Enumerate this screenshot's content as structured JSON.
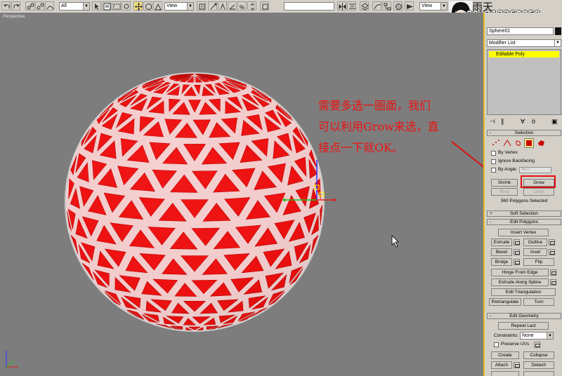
{
  "toolbar": {
    "selection_filter": "All",
    "ref_coord_1": "View",
    "ref_coord_2": "View",
    "named_selection": ""
  },
  "viewport": {
    "label": "Perspective",
    "annotation_lines": [
      "需要多选一圈面，我们",
      "可以利用Grow来选，直",
      "接点一下就OK。"
    ],
    "colors": {
      "background": "#7d7d7d",
      "sphere_face": "#ee1111",
      "sphere_edge": "#ffffff",
      "annotation": "#ee1111"
    }
  },
  "watermark": {
    "logo": "雨天",
    "qq": "QQ:313360058"
  },
  "command_panel": {
    "object_name": "Sphere01",
    "object_color": "#111111",
    "modifier_list": "Modifier List",
    "stack_item": "Editable Poly",
    "selection": {
      "title": "Selection",
      "by_vertex": "By Vertex",
      "ignore_backfacing": "Ignore Backfacing",
      "by_angle": "By Angle:",
      "angle_value": "45.0",
      "shrink": "Shrink",
      "grow": "Grow",
      "ring": "Ring",
      "loop": "Loop",
      "status": "360 Polygons Selected"
    },
    "soft_selection": {
      "title": "Soft Selection"
    },
    "edit_polygons": {
      "title": "Edit Polygons",
      "insert_vertex": "Insert Vertex",
      "extrude": "Extrude",
      "outline": "Outline",
      "bevel": "Bevel",
      "inset": "Inset",
      "bridge": "Bridge",
      "flip": "Flip",
      "hinge_from_edge": "Hinge From Edge",
      "extrude_along_spline": "Extrude Along Spline",
      "edit_triangulation": "Edit Triangulation",
      "retriangulate": "Retriangulate",
      "turn": "Turn"
    },
    "edit_geometry": {
      "title": "Edit Geometry",
      "repeat_last": "Repeat Last",
      "constraints_label": "Constraints:",
      "constraints_value": "None",
      "preserve_uvs": "Preserve UVs",
      "create": "Create",
      "collapse": "Collapse",
      "attach": "Attach",
      "detach": "Detach"
    }
  }
}
